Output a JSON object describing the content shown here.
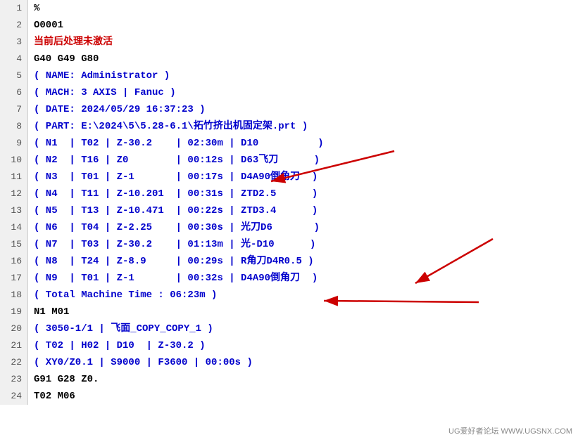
{
  "lines": [
    {
      "num": 1,
      "content": "%",
      "style": "black"
    },
    {
      "num": 2,
      "content": "O0001",
      "style": "black"
    },
    {
      "num": 3,
      "content": "当前后处理未激活",
      "style": "red-chinese"
    },
    {
      "num": 4,
      "content": "G40 G49 G80",
      "style": "black"
    },
    {
      "num": 5,
      "content": "( NAME: Administrator )",
      "style": "blue"
    },
    {
      "num": 6,
      "content": "( MACH: 3 AXIS | Fanuc )",
      "style": "blue"
    },
    {
      "num": 7,
      "content": "( DATE: 2024/05/29 16:37:23 )",
      "style": "blue"
    },
    {
      "num": 8,
      "content": "( PART: E:\\2024\\5\\5.28-6.1\\拓竹挤出机固定架.prt )",
      "style": "blue"
    },
    {
      "num": 9,
      "content": "( N1  | T02 | Z-30.2    | 02:30m | D10          )",
      "style": "blue"
    },
    {
      "num": 10,
      "content": "( N2  | T16 | Z0        | 00:12s | D63飞刀      )",
      "style": "blue"
    },
    {
      "num": 11,
      "content": "( N3  | T01 | Z-1       | 00:17s | D4A90倒角刀  )",
      "style": "blue"
    },
    {
      "num": 12,
      "content": "( N4  | T11 | Z-10.201  | 00:31s | ZTD2.5      )",
      "style": "blue"
    },
    {
      "num": 13,
      "content": "( N5  | T13 | Z-10.471  | 00:22s | ZTD3.4      )",
      "style": "blue"
    },
    {
      "num": 14,
      "content": "( N6  | T04 | Z-2.25    | 00:30s | 光刀D6       )",
      "style": "blue"
    },
    {
      "num": 15,
      "content": "( N7  | T03 | Z-30.2    | 01:13m | 光-D10      )",
      "style": "blue"
    },
    {
      "num": 16,
      "content": "( N8  | T24 | Z-8.9     | 00:29s | R角刀D4R0.5 )",
      "style": "blue"
    },
    {
      "num": 17,
      "content": "( N9  | T01 | Z-1       | 00:32s | D4A90倒角刀  )",
      "style": "blue"
    },
    {
      "num": 18,
      "content": "( Total Machine Time : 06:23m )",
      "style": "blue"
    },
    {
      "num": 19,
      "content": "N1 M01",
      "style": "black"
    },
    {
      "num": 20,
      "content": "( 3050-1/1 | 飞面_COPY_COPY_1 )",
      "style": "blue"
    },
    {
      "num": 21,
      "content": "( T02 | H02 | D10  | Z-30.2 )",
      "style": "blue"
    },
    {
      "num": 22,
      "content": "( XY0/Z0.1 | S9000 | F3600 | 00:00s )",
      "style": "blue"
    },
    {
      "num": 23,
      "content": "G91 G28 Z0.",
      "style": "black"
    },
    {
      "num": 24,
      "content": "T02 M06",
      "style": "black"
    }
  ],
  "watermark": "UG爱好者论坛 WWW.UGSNX.COM"
}
